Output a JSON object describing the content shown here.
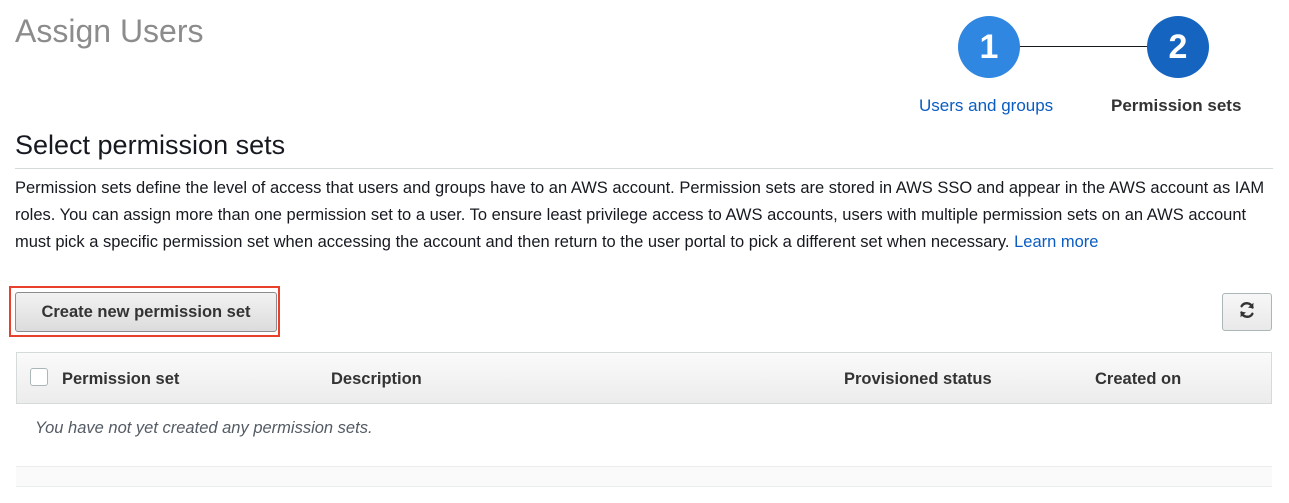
{
  "page": {
    "title": "Assign Users"
  },
  "stepper": {
    "steps": [
      {
        "number": "1",
        "label": "Users and groups"
      },
      {
        "number": "2",
        "label": "Permission sets"
      }
    ]
  },
  "section": {
    "title": "Select permission sets",
    "description": "Permission sets define the level of access that users and groups have to an AWS account. Permission sets are stored in AWS SSO and appear in the AWS account as IAM roles. You can assign more than one permission set to a user. To ensure least privilege access to AWS accounts, users with multiple permission sets on an AWS account must pick a specific permission set when accessing the account and then return to the user portal to pick a different set when necessary.",
    "learn_more": "Learn more"
  },
  "toolbar": {
    "create_label": "Create new permission set",
    "refresh_icon": "refresh-icon"
  },
  "table": {
    "columns": [
      "Permission set",
      "Description",
      "Provisioned status",
      "Created on"
    ],
    "empty_message": "You have not yet created any permission sets."
  },
  "colors": {
    "link": "#0a5cc2",
    "step_active": "#1565c0",
    "step_done": "#2f87e2",
    "highlight": "#e8402a"
  }
}
